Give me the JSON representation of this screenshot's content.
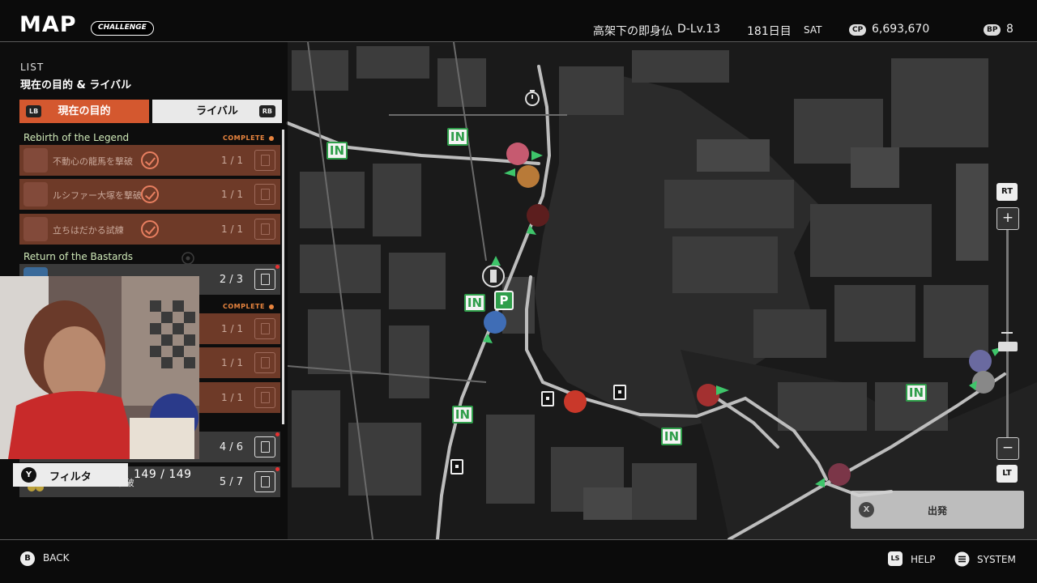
{
  "header": {
    "title": "MAP",
    "mode_badge": "CHALLENGE",
    "location": "高架下の即身仏",
    "danger_level": "D-Lv.13",
    "day": "181日目",
    "weekday": "SAT",
    "cp_label": "CP",
    "cp_value": "6,693,670",
    "bp_label": "BP",
    "bp_value": "8"
  },
  "panel": {
    "heading": "LIST",
    "subheading": "現在の目的 & ライバル",
    "tabs": [
      {
        "label": "現在の目的",
        "key": "LB"
      },
      {
        "label": "ライバル",
        "key": "RB"
      }
    ],
    "groups": [
      {
        "title": "Rebirth of the Legend",
        "status": "COMPLETE",
        "items": [
          {
            "label": "不動心の龍馬を撃破",
            "count": "1 / 1"
          },
          {
            "label": "ルシファー大塚を撃破",
            "count": "1 / 1"
          },
          {
            "label": "立ちはだかる試練",
            "count": "1 / 1"
          }
        ]
      },
      {
        "title": "Return of the Bastards",
        "items": [
          {
            "label": "",
            "count": "2 / 3"
          }
        ]
      },
      {
        "status": "COMPLETE",
        "items": [
          {
            "label": "",
            "count": "1 / 1"
          },
          {
            "label": "",
            "count": "1 / 1"
          },
          {
            "label": "",
            "count": "1 / 1"
          }
        ]
      },
      {
        "items": [
          {
            "label": "",
            "count": "4 / 6"
          },
          {
            "label": "<TWISTER>を撃破",
            "count": "5 / 7"
          }
        ]
      }
    ],
    "filter_button": "Y",
    "filter_label": "フィルタ",
    "filter_count": "149 / 149"
  },
  "map": {
    "in_label": "IN",
    "parking_label": "P",
    "zoom": {
      "top_key": "RT",
      "plus": "+",
      "minus": "−",
      "bottom_key": "LT",
      "level": 0.72
    },
    "depart_button": "X",
    "depart_label": "出発"
  },
  "footer": {
    "back_button": "B",
    "back_label": "BACK",
    "help_button": "LS",
    "help_label": "HELP",
    "system_label": "SYSTEM"
  },
  "colors": {
    "accent": "#d4582f",
    "complete": "#e8843e",
    "marker_green": "#2f9e4a",
    "group_title": "#cfe9b8"
  }
}
